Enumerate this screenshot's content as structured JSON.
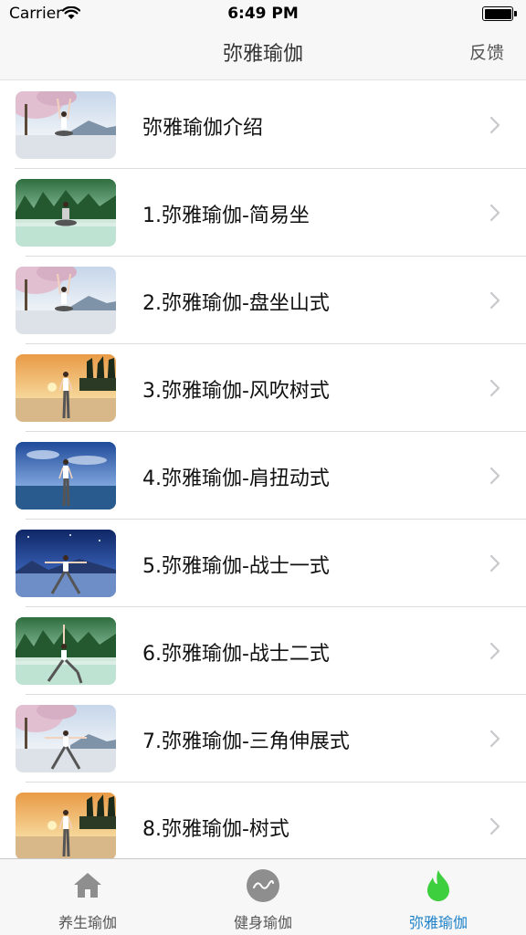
{
  "status_bar": {
    "carrier": "Carrier",
    "time": "6:49 PM"
  },
  "nav": {
    "title": "弥雅瑜伽",
    "feedback": "反馈"
  },
  "list": {
    "items": [
      {
        "label": "弥雅瑜伽介绍",
        "scene": "blossom",
        "pose": "arms-up"
      },
      {
        "label": "1.弥雅瑜伽-简易坐",
        "scene": "forest",
        "pose": "seated"
      },
      {
        "label": "2.弥雅瑜伽-盘坐山式",
        "scene": "blossom",
        "pose": "arms-up"
      },
      {
        "label": "3.弥雅瑜伽-风吹树式",
        "scene": "sunset",
        "pose": "standing"
      },
      {
        "label": "4.弥雅瑜伽-肩扭动式",
        "scene": "sea",
        "pose": "standing"
      },
      {
        "label": "5.弥雅瑜伽-战士一式",
        "scene": "night",
        "pose": "warrior"
      },
      {
        "label": "6.弥雅瑜伽-战士二式",
        "scene": "forest",
        "pose": "lunge"
      },
      {
        "label": "7.弥雅瑜伽-三角伸展式",
        "scene": "blossom",
        "pose": "warrior"
      },
      {
        "label": "8.弥雅瑜伽-树式",
        "scene": "sunset",
        "pose": "standing"
      }
    ]
  },
  "tab_bar": {
    "tabs": [
      {
        "label": "养生瑜伽",
        "icon": "home-icon",
        "active": false
      },
      {
        "label": "健身瑜伽",
        "icon": "wave-circle-icon",
        "active": false
      },
      {
        "label": "弥雅瑜伽",
        "icon": "flame-icon",
        "active": true
      }
    ]
  },
  "colors": {
    "accent": "#1e82c8",
    "flame": "#3ecf3e",
    "separator": "#dcdcdc",
    "bar_background": "#f7f7f7"
  }
}
